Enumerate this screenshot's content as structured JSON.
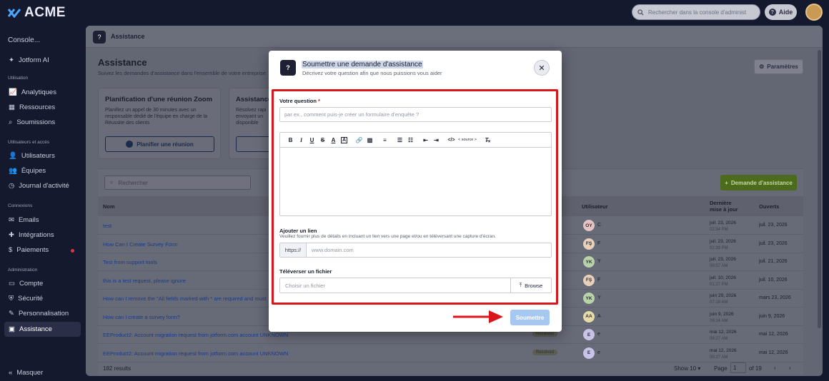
{
  "brand": {
    "name": "ACME"
  },
  "topbar": {
    "search_placeholder": "Rechercher dans la console d'administ",
    "help_label": "Aide"
  },
  "sidebar": {
    "console_label": "Console...",
    "ai_label": "Jotform AI",
    "sections": {
      "usage": "Utilisation",
      "users": "Utilisateurs et accès",
      "connections": "Connexions",
      "admin": "Administration"
    },
    "items": {
      "analytics": "Analytiques",
      "resources": "Ressources",
      "submissions": "Soumissions",
      "users": "Utilisateurs",
      "teams": "Équipes",
      "activity": "Journal d'activité",
      "emails": "Emails",
      "integrations": "Intégrations",
      "payments": "Paiements",
      "account": "Compte",
      "security": "Sécurité",
      "personalization": "Personnalisation",
      "assistance": "Assistance"
    },
    "collapse_label": "Masquer"
  },
  "main": {
    "header_title": "Assistance",
    "page_title": "Assistance",
    "page_subtitle": "Suivez les demandes d'assistance dans l'ensemble de votre entreprise",
    "settings_label": "Paramètres",
    "card1": {
      "title": "Planification d'une réunion Zoom",
      "text": "Planifiez un appel de 30 minutes avec un responsable dédié de l'équipe en charge de la Réussite des clients",
      "button": "Planifier une réunion"
    },
    "card2": {
      "title": "Assistance",
      "text": "Résolvez rapi envoyant un disponible"
    },
    "table": {
      "search_placeholder": "Rechercher",
      "new_button": "Demande d'assistance",
      "headers": {
        "name": "Nom",
        "user": "Utilisateur",
        "updated_line1": "Dernière",
        "updated_line2": "mise à jour",
        "opened": "Ouverts"
      },
      "rows": [
        {
          "title": "test",
          "initials": "OY",
          "user": "C",
          "d1": "juil. 23, 2026",
          "t1": "02:34 PM",
          "d2": "juil. 23, 2026"
        },
        {
          "title": "How Can I Create Survey Form",
          "initials": "FŞ",
          "user": "F",
          "d1": "juil. 23, 2026",
          "t1": "02:39 PM",
          "d2": "juil. 23, 2026"
        },
        {
          "title": "Test from support tools",
          "initials": "YK",
          "user": "Y",
          "d1": "juil. 23, 2026",
          "t1": "09:57 AM",
          "d2": "juil. 21, 2026"
        },
        {
          "title": "this is a test request, please ignore",
          "initials": "FŞ",
          "user": "F",
          "d1": "juil. 10, 2026",
          "t1": "01:27 PM",
          "d2": "juil. 10, 2026"
        },
        {
          "title": "How can I remove the \"All fields marked with * are required and must",
          "initials": "YK",
          "user": "Y",
          "d1": "juin 29, 2026",
          "t1": "07:18 AM",
          "d2": "mars 23, 2026"
        },
        {
          "title": "How can I create a survey form?",
          "initials": "AA",
          "user": "A",
          "d1": "juin 9, 2026",
          "t1": "09:14 AM",
          "d2": "juin 9, 2026"
        },
        {
          "title": "EEProduct2: Account migration request from jotform.com account UNKNOWN",
          "badge": "Resolved",
          "initials": "E",
          "user": "e",
          "d1": "mai 12, 2026",
          "t1": "09:27 AM",
          "d2": "mai 12, 2026"
        },
        {
          "title": "EEProduct2: Account migration request from jotform.com account UNKNOWN",
          "badge": "Resolved",
          "initials": "E",
          "user": "e",
          "d1": "mai 12, 2026",
          "t1": "09:27 AM",
          "d2": "mai 12, 2026"
        }
      ],
      "results": "182 results",
      "show_label": "Show 10",
      "page_label": "Page",
      "page_value": "1",
      "page_of": "of 19"
    }
  },
  "modal": {
    "title": "Soumettre une demande d'assistance",
    "subtitle": "Décrivez votre question afin que nous puissions vous aider",
    "question_label": "Votre question",
    "required_mark": "*",
    "question_placeholder": "par ex., comment puis-je créer un formulaire d'enquête ?",
    "source_label": "< source >",
    "link_label": "Ajouter un lien",
    "link_hint": "Veuillez fournir plus de détails en incluant un lien vers une page et/ou en téléversant une capture d'écran.",
    "link_prefix": "https://",
    "link_placeholder": "www.domain.com",
    "upload_label": "Téléverser un fichier",
    "upload_placeholder": "Choisir un fichier",
    "browse_label": "Browse",
    "submit_label": "Soumettre"
  },
  "colors": {
    "highlight_box": "#d9161c",
    "submit_disabled": "#a6c8f0",
    "primary_green": "#4c6b1c"
  }
}
